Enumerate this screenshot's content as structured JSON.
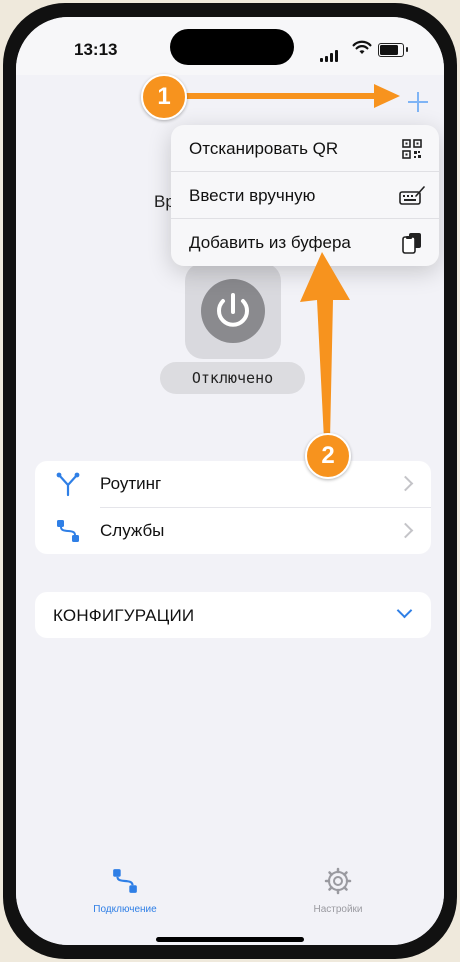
{
  "status_bar": {
    "time": "13:13"
  },
  "background_text": "Вр",
  "menu": {
    "items": [
      {
        "label": "Отсканировать QR",
        "icon": "qr-code-icon"
      },
      {
        "label": "Ввести вручную",
        "icon": "keyboard-icon"
      },
      {
        "label": "Добавить из буфера",
        "icon": "clipboard-icon"
      }
    ]
  },
  "connection": {
    "status": "Отключено"
  },
  "list": {
    "items": [
      {
        "label": "Роутинг",
        "icon": "routing-icon"
      },
      {
        "label": "Службы",
        "icon": "services-icon"
      }
    ]
  },
  "configurations": {
    "label": "КОНФИГУРАЦИИ"
  },
  "tabbar": {
    "tabs": [
      {
        "label": "Подключение",
        "icon": "connection-icon",
        "active": true
      },
      {
        "label": "Настройки",
        "icon": "settings-gear-icon",
        "active": false
      }
    ]
  },
  "annotations": [
    {
      "number": "1"
    },
    {
      "number": "2"
    }
  ],
  "colors": {
    "accent": "#2f7fe6",
    "annotation": "#f7931e",
    "background": "#f2f2f7"
  }
}
